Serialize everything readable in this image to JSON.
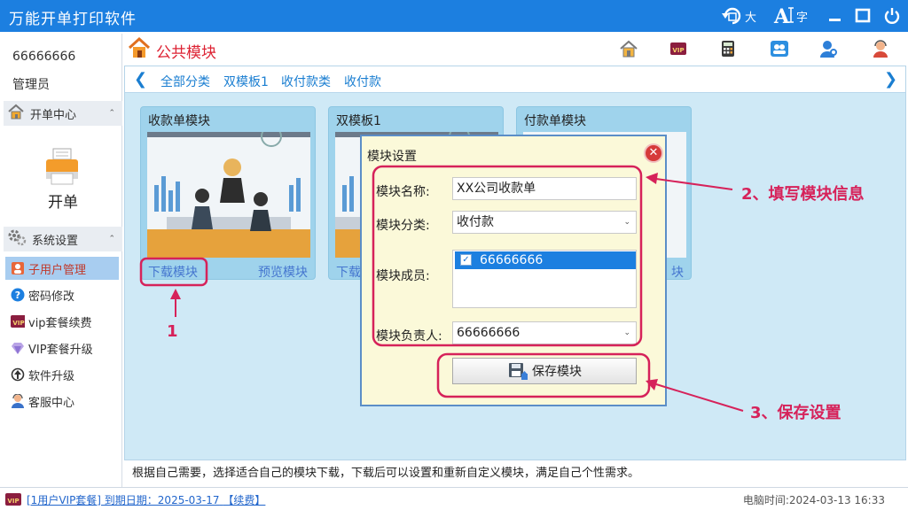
{
  "app": {
    "title": "万能开单打印软件"
  },
  "titlebar": {
    "big_label": "大",
    "font_label": "字"
  },
  "sidebar": {
    "user_id": "66666666",
    "role": "管理员",
    "order_center": {
      "label": "开单中心"
    },
    "open_order": {
      "label": "开单"
    },
    "system_settings": {
      "label": "系统设置"
    },
    "items": [
      {
        "label": "子用户管理",
        "icon": "user-icon",
        "active": true
      },
      {
        "label": "密码修改",
        "icon": "question-icon",
        "active": false
      },
      {
        "label": "vip套餐续费",
        "icon": "vip-icon",
        "active": false
      },
      {
        "label": "VIP套餐升级",
        "icon": "diamond-icon",
        "active": false
      },
      {
        "label": "软件升级",
        "icon": "upgrade-icon",
        "active": false
      },
      {
        "label": "客服中心",
        "icon": "support-icon",
        "active": false
      }
    ]
  },
  "main": {
    "title": "公共模块",
    "header_icons": [
      "home-icon",
      "vip-icon",
      "calculator-icon",
      "users-icon",
      "user-key-icon",
      "support-icon"
    ],
    "breadcrumbs": [
      "全部分类",
      "双模板1",
      "收付款类",
      "收付款"
    ],
    "cards": [
      {
        "title": "收款单模块",
        "download": "下载模块",
        "preview": "预览模块"
      },
      {
        "title": "双模板1",
        "download": "下载",
        "preview": ""
      },
      {
        "title": "付款单模块",
        "download": "",
        "preview": "块"
      }
    ],
    "description": "根据自己需要，选择适合自己的模块下载，下载后可以设置和重新自定义模块，满足自己个性需求。"
  },
  "dialog": {
    "title": "模块设置",
    "name_label": "模块名称:",
    "name_value": "XX公司收款单",
    "category_label": "模块分类:",
    "category_value": "收付款",
    "members_label": "模块成员:",
    "member_item": "66666666",
    "owner_label": "模块负责人:",
    "owner_value": "66666666",
    "save_label": "保存模块"
  },
  "annotations": {
    "step1": "1",
    "step2": "2、填写模块信息",
    "step3": "3、保存设置"
  },
  "status": {
    "vip_text": "[1用户VIP套餐] 到期日期：2025-03-17",
    "renew": "【续费】",
    "clock": "电脑时间:2024-03-13 16:33"
  },
  "colors": {
    "titlebar": "#1c7fe0",
    "accent": "#1a7ed1",
    "annotation": "#d6225a",
    "panel": "#cfe9f6"
  }
}
